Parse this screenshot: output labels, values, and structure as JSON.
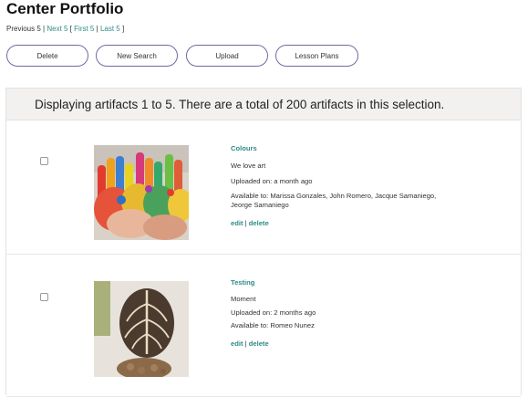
{
  "page": {
    "title": "Center Portfolio"
  },
  "pager": {
    "previous": "Previous 5",
    "next": "Next 5",
    "first": "First 5",
    "last": "Last 5"
  },
  "actions": {
    "delete": "Delete",
    "new_search": "New Search",
    "upload": "Upload",
    "lesson_plans": "Lesson Plans"
  },
  "results": {
    "summary": "Displaying artifacts 1 to 5. There are a total of 200 artifacts in this selection."
  },
  "artifacts": [
    {
      "name": "Colours",
      "description": "We love art",
      "uploaded": "Uploaded on: a month ago",
      "available": "Available to: Marissa Gonzales, John Romero, Jacque Samaniego, Jeorge Samaniego",
      "edit": "edit",
      "delete": "delete",
      "image": "painted-hands-photo"
    },
    {
      "name": "Testing",
      "description": "Moment",
      "uploaded": "Uploaded on: 2 months ago",
      "available": "Available to: Romeo Nunez",
      "edit": "edit",
      "delete": "delete",
      "image": "leaf-plant-photo"
    }
  ],
  "colors": {
    "link": "#2e8b86",
    "button_border": "#6f6aa3",
    "header_bg": "#f2f1ef"
  }
}
